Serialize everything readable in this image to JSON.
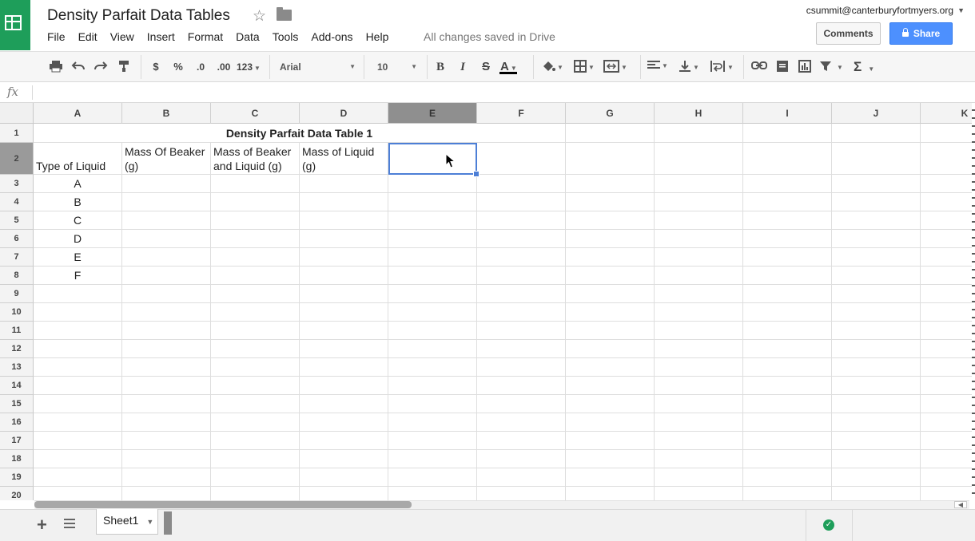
{
  "document": {
    "title": "Density Parfait Data Tables",
    "save_status": "All changes saved in Drive"
  },
  "menu": [
    "File",
    "Edit",
    "View",
    "Insert",
    "Format",
    "Data",
    "Tools",
    "Add-ons",
    "Help"
  ],
  "account": {
    "email": "csummit@canterburyfortmyers.org",
    "comments_label": "Comments",
    "share_label": "Share"
  },
  "toolbar": {
    "currency": "$",
    "percent": "%",
    "decrease_decimal": ".0",
    "increase_decimal": ".00",
    "more_formats": "123",
    "font_name": "Arial",
    "font_size": "10",
    "bold": "B",
    "italic": "I",
    "strikethrough": "S",
    "text_color": "A",
    "functions": "Σ"
  },
  "formula_bar": {
    "fx_label": "fx",
    "value": ""
  },
  "columns": [
    "A",
    "B",
    "C",
    "D",
    "E",
    "F",
    "G",
    "H",
    "I",
    "J",
    "K"
  ],
  "rows": [
    "1",
    "2",
    "3",
    "4",
    "5",
    "6",
    "7",
    "8",
    "9",
    "10",
    "11",
    "12",
    "13",
    "14",
    "15",
    "16",
    "17",
    "18",
    "19",
    "20"
  ],
  "selected_cell": "E2",
  "table": {
    "title": "Density Parfait Data Table 1",
    "headers": [
      "Type of Liquid",
      "Mass Of Beaker (g)",
      "Mass of Beaker and Liquid (g)",
      "Mass of Liquid (g)"
    ],
    "liquids": [
      "A",
      "B",
      "C",
      "D",
      "E",
      "F"
    ]
  },
  "sheets": [
    {
      "name": "Sheet1",
      "active": true
    }
  ],
  "colors": {
    "brand_green": "#1e9e5a",
    "share_blue": "#4d90fe",
    "selection_blue": "#4d7fd6"
  }
}
